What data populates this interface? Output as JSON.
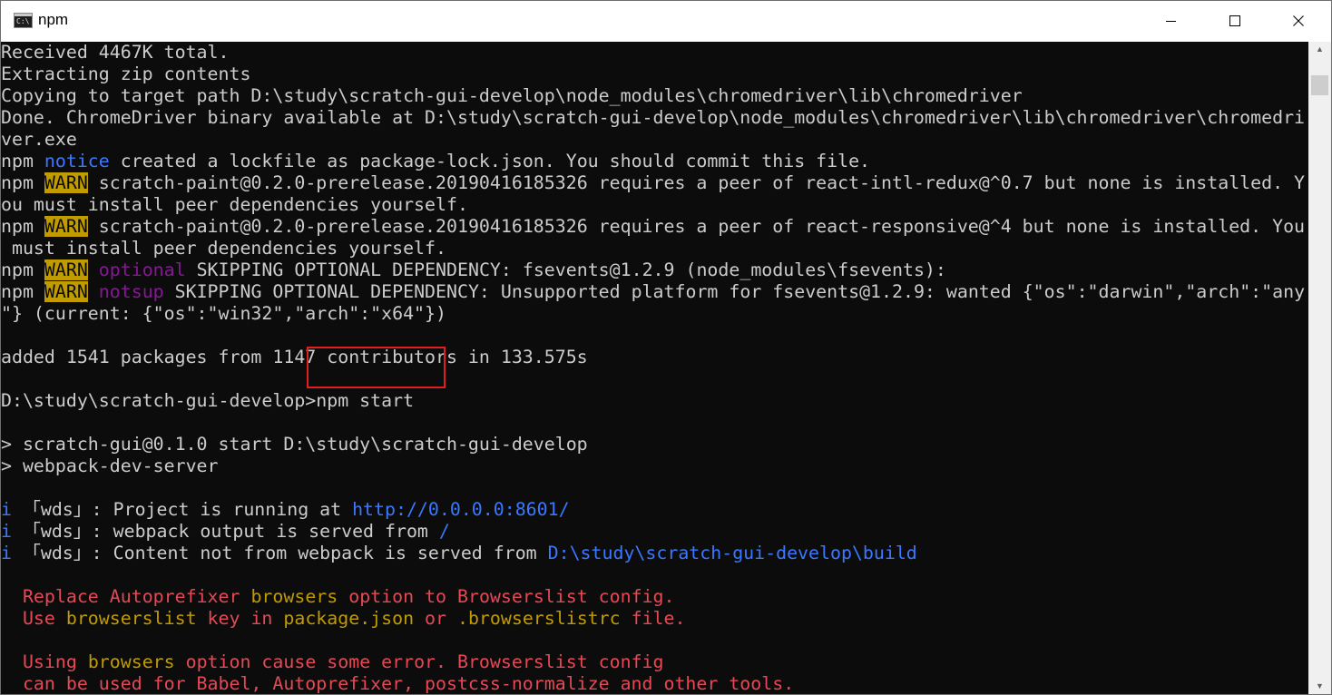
{
  "window": {
    "title": "npm",
    "icon_text": "C:\\",
    "icons": {
      "minimize": "minimize-icon",
      "maximize": "maximize-icon",
      "close": "close-icon"
    }
  },
  "colors": {
    "console_bg": "#0c0c0c",
    "default_text": "#cccccc",
    "warn_bg": "#c19c00",
    "blue": "#3b78ff",
    "purple": "#881798",
    "red": "#e74856",
    "yellow": "#c19c00",
    "highlight_border": "#e02020"
  },
  "console": {
    "lines": [
      [
        {
          "t": "Received 4467K total."
        }
      ],
      [
        {
          "t": "Extracting zip contents"
        }
      ],
      [
        {
          "t": "Copying to target path D:\\study\\scratch-gui-develop\\node_modules\\chromedriver\\lib\\chromedriver"
        }
      ],
      [
        {
          "t": "Done. ChromeDriver binary available at D:\\study\\scratch-gui-develop\\node_modules\\chromedriver\\lib\\chromedriver\\chromedri"
        }
      ],
      [
        {
          "t": "ver.exe"
        }
      ],
      [
        {
          "t": "npm "
        },
        {
          "t": "notice",
          "c": "blue"
        },
        {
          "t": " created a lockfile as package-lock.json. You should commit this file."
        }
      ],
      [
        {
          "t": "npm "
        },
        {
          "t": "WARN",
          "c": "warn"
        },
        {
          "t": " scratch-paint@0.2.0-prerelease.20190416185326 requires a peer of react-intl-redux@^0.7 but none is installed. Y"
        }
      ],
      [
        {
          "t": "ou must install peer dependencies yourself."
        }
      ],
      [
        {
          "t": "npm "
        },
        {
          "t": "WARN",
          "c": "warn"
        },
        {
          "t": " scratch-paint@0.2.0-prerelease.20190416185326 requires a peer of react-responsive@^4 but none is installed. You"
        }
      ],
      [
        {
          "t": " must install peer dependencies yourself."
        }
      ],
      [
        {
          "t": "npm "
        },
        {
          "t": "WARN",
          "c": "warn"
        },
        {
          "t": " "
        },
        {
          "t": "optional",
          "c": "purple"
        },
        {
          "t": " SKIPPING OPTIONAL DEPENDENCY: fsevents@1.2.9 (node_modules\\fsevents):"
        }
      ],
      [
        {
          "t": "npm "
        },
        {
          "t": "WARN",
          "c": "warn"
        },
        {
          "t": " "
        },
        {
          "t": "notsup",
          "c": "purple"
        },
        {
          "t": " SKIPPING OPTIONAL DEPENDENCY: Unsupported platform for fsevents@1.2.9: wanted {\"os\":\"darwin\",\"arch\":\"any"
        }
      ],
      [
        {
          "t": "\"} (current: {\"os\":\"win32\",\"arch\":\"x64\"})"
        }
      ],
      [
        {
          "t": ""
        }
      ],
      [
        {
          "t": "added 1541 packages from 1147 contributors in 133.575s"
        }
      ],
      [
        {
          "t": ""
        }
      ],
      [
        {
          "t": "D:\\study\\scratch-gui-develop>npm start"
        }
      ],
      [
        {
          "t": ""
        }
      ],
      [
        {
          "t": "> scratch-gui@0.1.0 start D:\\study\\scratch-gui-develop"
        }
      ],
      [
        {
          "t": "> webpack-dev-server"
        }
      ],
      [
        {
          "t": ""
        }
      ],
      [
        {
          "t": "i",
          "c": "blue"
        },
        {
          "t": " 「wds」: Project is running at "
        },
        {
          "t": "http://0.0.0.0:8601/",
          "c": "blue"
        }
      ],
      [
        {
          "t": "i",
          "c": "blue"
        },
        {
          "t": " 「wds」: webpack output is served from "
        },
        {
          "t": "/",
          "c": "blue"
        }
      ],
      [
        {
          "t": "i",
          "c": "blue"
        },
        {
          "t": " 「wds」: Content not from webpack is served from "
        },
        {
          "t": "D:\\study\\scratch-gui-develop\\build",
          "c": "blue"
        }
      ],
      [
        {
          "t": ""
        }
      ],
      [
        {
          "t": "  Replace ",
          "c": "red"
        },
        {
          "t": "Autoprefixer",
          "c": "red"
        },
        {
          "t": " "
        },
        {
          "t": "browsers",
          "c": "yellow"
        },
        {
          "t": " option to ",
          "c": "red"
        },
        {
          "t": "Browserslist",
          "c": "red"
        },
        {
          "t": " config.",
          "c": "red"
        }
      ],
      [
        {
          "t": "  Use ",
          "c": "red"
        },
        {
          "t": "browserslist",
          "c": "yellow"
        },
        {
          "t": " key in ",
          "c": "red"
        },
        {
          "t": "package.json",
          "c": "yellow"
        },
        {
          "t": " or ",
          "c": "red"
        },
        {
          "t": ".browserslistrc",
          "c": "yellow"
        },
        {
          "t": " file.",
          "c": "red"
        }
      ],
      [
        {
          "t": ""
        }
      ],
      [
        {
          "t": "  Using ",
          "c": "red"
        },
        {
          "t": "browsers",
          "c": "yellow"
        },
        {
          "t": " option cause some error. Browserslist config",
          "c": "red"
        }
      ],
      [
        {
          "t": "  can be used for Babel, Autoprefixer, postcss-normalize and other tools.",
          "c": "red"
        }
      ]
    ]
  },
  "scrollbar": {
    "up_arrow": "▲",
    "down_arrow": "▼",
    "position_fraction": 0.03
  }
}
